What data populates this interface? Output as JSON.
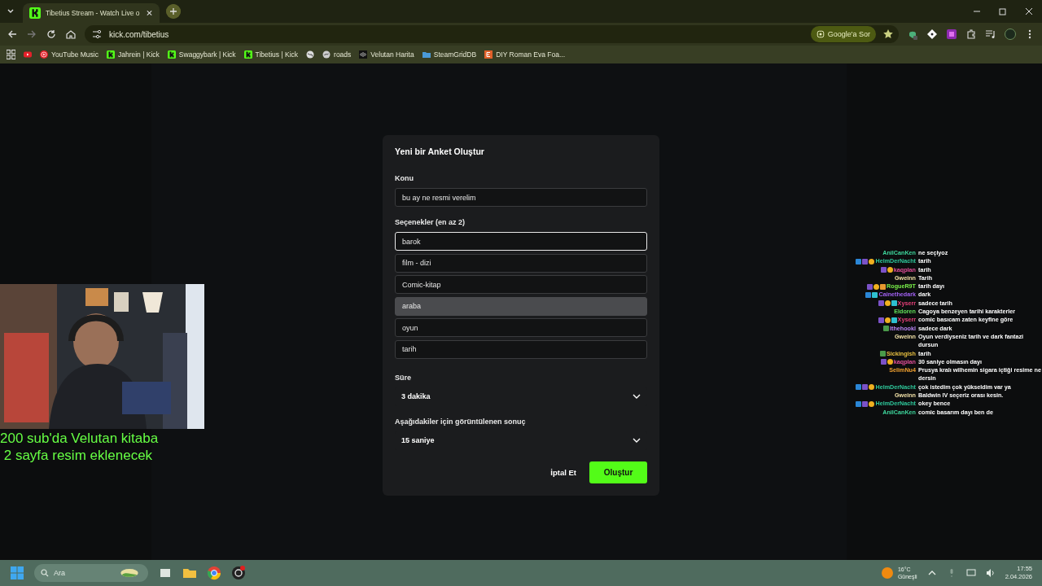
{
  "browser": {
    "tab": {
      "title": "Tibetius Stream - Watch Live o",
      "selected": true
    },
    "address": "kick.com/tibetius",
    "ask_button": "Google'a Sor",
    "bookmarks": [
      {
        "kind": "youtube"
      },
      {
        "kind": "music",
        "label": "YouTube Music"
      },
      {
        "kind": "kick",
        "label": "Jahrein | Kick"
      },
      {
        "kind": "kick",
        "label": "Swaggybark | Kick"
      },
      {
        "kind": "kick",
        "label": "Tibetius | Kick"
      },
      {
        "kind": "globe"
      },
      {
        "kind": "disc",
        "label": "roads"
      },
      {
        "kind": "map",
        "label": "Velutan Harita"
      },
      {
        "kind": "folder",
        "label": "SteamGridDB"
      },
      {
        "kind": "letter",
        "label": "DIY Roman Eva Foa..."
      }
    ]
  },
  "poll_dialog": {
    "title": "Yeni bir Anket Oluştur",
    "topic": {
      "label": "Konu",
      "value": "bu ay ne resmi verelim"
    },
    "options": {
      "label": "Seçenekler (en az 2)",
      "items": [
        {
          "value": "barok",
          "focused": true,
          "hovered": false
        },
        {
          "value": "film - dizi",
          "focused": false,
          "hovered": false
        },
        {
          "value": "Comic-kitap",
          "focused": false,
          "hovered": false
        },
        {
          "value": "araba",
          "focused": false,
          "hovered": true
        },
        {
          "value": "oyun",
          "focused": false,
          "hovered": false
        },
        {
          "value": "tarih",
          "focused": false,
          "hovered": false
        }
      ]
    },
    "duration": {
      "label": "Süre",
      "value": "3 dakika"
    },
    "result": {
      "label": "Aşağıdakiler için görüntülenen sonuç",
      "value": "15 saniye"
    },
    "cancel_button": "İptal Et",
    "create_button": "Oluştur"
  },
  "stream_overlay": {
    "banner": [
      "200 sub'da Velutan kitaba",
      "2 sayfa resim eklenecek"
    ],
    "chat": [
      {
        "user": "AnilCanKen",
        "color": "#3ed69c",
        "text": "ne seçiyoz"
      },
      {
        "user": "HelmDerNacht",
        "color": "#2ec79a",
        "badges": [
          {
            "kind": "moderator"
          },
          {
            "kind": "subscriber"
          },
          {
            "kind": "gifter"
          }
        ],
        "text": "tarih"
      },
      {
        "user": "kaqplan",
        "color": "#e2509a",
        "badges": [
          {
            "kind": "subscriber"
          },
          {
            "kind": "gifter"
          }
        ],
        "text": "tarih"
      },
      {
        "user": "Gweinn",
        "color": "#f2e2a8",
        "text": "Tarih"
      },
      {
        "user": "RogueR9T",
        "color": "#7af04a",
        "badges": [
          {
            "kind": "subscriber"
          },
          {
            "kind": "gifter"
          },
          {
            "kind": "founder"
          }
        ],
        "text": "tarih dayı"
      },
      {
        "user": "Cainethedark",
        "color": "#a060f0",
        "badges": [
          {
            "kind": "moderator"
          },
          {
            "kind": "og"
          }
        ],
        "text": "dark"
      },
      {
        "user": "Xyserr",
        "color": "#e8407a",
        "badges": [
          {
            "kind": "subscriber"
          },
          {
            "kind": "gifter"
          },
          {
            "kind": "og"
          }
        ],
        "text": "sadece tarih"
      },
      {
        "user": "Eldoren",
        "color": "#62e05a",
        "text": "Cagoya benzeyen tarihi karakterler"
      },
      {
        "user": "Xyserr",
        "color": "#e8407a",
        "badges": [
          {
            "kind": "subscriber"
          },
          {
            "kind": "gifter"
          },
          {
            "kind": "og"
          }
        ],
        "text": "comic basıcam zaten keyfine göre"
      },
      {
        "user": "Ithehookl",
        "color": "#b884f4",
        "badges": [
          {
            "kind": "veteran"
          }
        ],
        "text": "sadece dark"
      },
      {
        "user": "Gweinn",
        "color": "#f2e2a8",
        "text": "Oyun verdiyseniz tarih ve dark fantazi dursun"
      },
      {
        "user": "Sickingish",
        "color": "#e8c040",
        "badges": [
          {
            "kind": "veteran"
          }
        ],
        "text": "tarih"
      },
      {
        "user": "kaqplan",
        "color": "#e2509a",
        "badges": [
          {
            "kind": "subscriber"
          },
          {
            "kind": "gifter"
          }
        ],
        "text": "30 saniye olmasın dayı"
      },
      {
        "user": "SelimNu4",
        "color": "#f0a030",
        "text": "Prusya kralı wilhemin sigara içtiği resime ne dersin"
      },
      {
        "user": "HelmDerNacht",
        "color": "#2ec79a",
        "badges": [
          {
            "kind": "moderator"
          },
          {
            "kind": "subscriber"
          },
          {
            "kind": "gifter"
          }
        ],
        "text": "çok istedim çok yükseldim var ya"
      },
      {
        "user": "Gweinn",
        "color": "#f2e2a8",
        "text": "Baldwin IV seçeriz orası kesin."
      },
      {
        "user": "HelmDerNacht",
        "color": "#2ec79a",
        "badges": [
          {
            "kind": "moderator"
          },
          {
            "kind": "subscriber"
          },
          {
            "kind": "gifter"
          }
        ],
        "text": "okey bence"
      },
      {
        "user": "AnilCanKen",
        "color": "#3ed69c",
        "text": "comic basarım dayı ben de"
      }
    ]
  },
  "taskbar": {
    "search_placeholder": "Ara",
    "weather": {
      "temperature": "16°C",
      "condition": "Güneşli"
    },
    "time": "17:55",
    "date": "2.04.2026"
  }
}
